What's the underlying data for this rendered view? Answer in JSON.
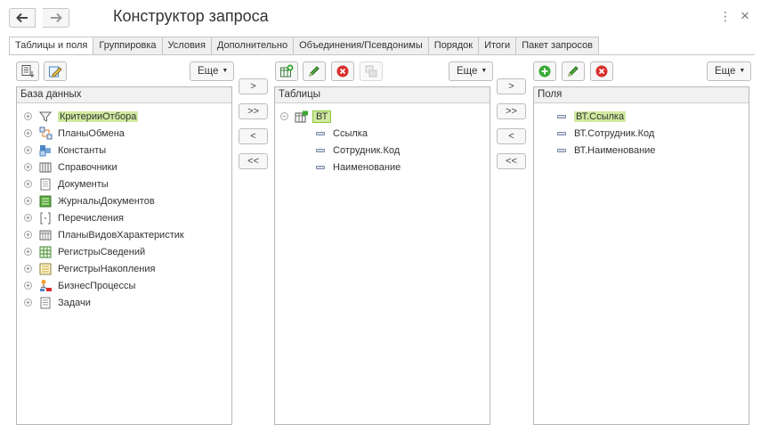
{
  "window": {
    "title": "Конструктор запроса",
    "icons": [
      "back-arrow-icon",
      "forward-arrow-icon",
      "more-vert-icon",
      "close-icon"
    ],
    "more_glyph": "⋮",
    "close_glyph": "×"
  },
  "tabs": [
    {
      "label": "Таблицы и поля",
      "active": true
    },
    {
      "label": "Группировка"
    },
    {
      "label": "Условия"
    },
    {
      "label": "Дополнительно"
    },
    {
      "label": "Объединения/Псевдонимы"
    },
    {
      "label": "Порядок"
    },
    {
      "label": "Итоги"
    },
    {
      "label": "Пакет запросов"
    }
  ],
  "more_label": "Еще",
  "transfer": {
    "add": ">",
    "add_all": ">>",
    "remove": "<",
    "remove_all": "<<"
  },
  "database": {
    "header": "База данных",
    "items": [
      {
        "label": "КритерииОтбора",
        "icon": "filter-icon",
        "highlighted": true
      },
      {
        "label": "ПланыОбмена",
        "icon": "exchange-plan-icon"
      },
      {
        "label": "Константы",
        "icon": "constants-icon"
      },
      {
        "label": "Справочники",
        "icon": "catalogs-icon"
      },
      {
        "label": "Документы",
        "icon": "documents-icon"
      },
      {
        "label": "ЖурналыДокументов",
        "icon": "document-journals-icon"
      },
      {
        "label": "Перечисления",
        "icon": "enumerations-icon"
      },
      {
        "label": "ПланыВидовХарактеристик",
        "icon": "characteristic-plans-icon"
      },
      {
        "label": "РегистрыСведений",
        "icon": "info-registers-icon"
      },
      {
        "label": "РегистрыНакопления",
        "icon": "accumulation-registers-icon"
      },
      {
        "label": "БизнесПроцессы",
        "icon": "business-processes-icon"
      },
      {
        "label": "Задачи",
        "icon": "tasks-icon"
      }
    ]
  },
  "tables": {
    "header": "Таблицы",
    "root": "ВТ",
    "fields": [
      "Ссылка",
      "Сотрудник.Код",
      "Наименование"
    ]
  },
  "fields": {
    "header": "Поля",
    "items": [
      {
        "label": "ВТ.Ссылка",
        "highlighted": true
      },
      {
        "label": "ВТ.Сотрудник.Код"
      },
      {
        "label": "ВТ.Наименование"
      }
    ]
  },
  "colors": {
    "accent_green": "#cfeaa0",
    "add_green": "#3aaa35",
    "delete_red": "#d9302c"
  }
}
